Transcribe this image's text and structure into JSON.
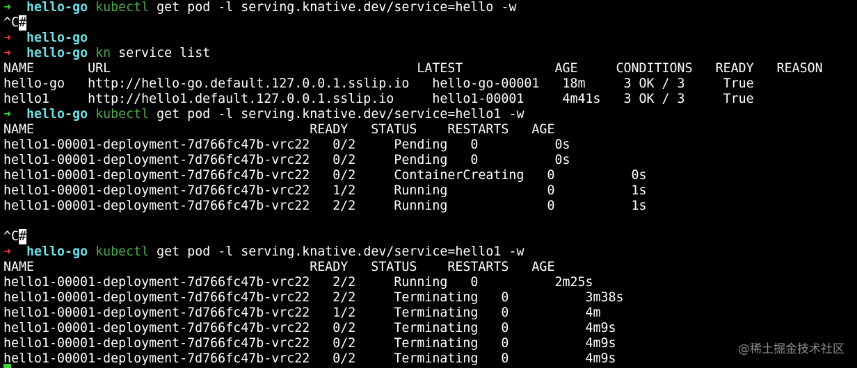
{
  "colors": {
    "background": "#000000",
    "text": "#ffffff",
    "prompt_arrow_success": "#38d838",
    "prompt_arrow_error": "#ee3a3a",
    "directory": "#6ee0e6",
    "command_name": "#4aa84a"
  },
  "prompt": {
    "arrow": "➜",
    "directory": "hello-go"
  },
  "session": {
    "cmd1": {
      "name": "kubectl",
      "args": " get pod -l serving.knative.dev/service=hello -w"
    },
    "interrupt": "^C",
    "cursor_char": "#",
    "cmd2": {
      "name": "kn",
      "args": " service list"
    },
    "service_header": "NAME       URL                                        LATEST            AGE     CONDITIONS   READY   REASON",
    "service_rows": [
      "hello-go   http://hello-go.default.127.0.0.1.sslip.io   hello-go-00001   18m     3 OK / 3     True",
      "hello1     http://hello1.default.127.0.0.1.sslip.io     hello1-00001     4m41s   3 OK / 3     True"
    ],
    "cmd3": {
      "name": "kubectl",
      "args": " get pod -l serving.knative.dev/service=hello1 -w"
    },
    "pod_header_1": "NAME                                    READY   STATUS    RESTARTS   AGE",
    "pod_rows_1": [
      "hello1-00001-deployment-7d766fc47b-vrc22   0/2     Pending   0          0s",
      "hello1-00001-deployment-7d766fc47b-vrc22   0/2     Pending   0          0s",
      "hello1-00001-deployment-7d766fc47b-vrc22   0/2     ContainerCreating   0          0s",
      "hello1-00001-deployment-7d766fc47b-vrc22   1/2     Running             0          1s",
      "hello1-00001-deployment-7d766fc47b-vrc22   2/2     Running             0          1s"
    ],
    "cmd4": {
      "name": "kubectl",
      "args": " get pod -l serving.knative.dev/service=hello1 -w"
    },
    "pod_header_2": "NAME                                    READY   STATUS    RESTARTS   AGE",
    "pod_rows_2": [
      "hello1-00001-deployment-7d766fc47b-vrc22   2/2     Running   0          2m25s",
      "hello1-00001-deployment-7d766fc47b-vrc22   2/2     Terminating   0          3m38s",
      "hello1-00001-deployment-7d766fc47b-vrc22   1/2     Terminating   0          4m",
      "hello1-00001-deployment-7d766fc47b-vrc22   0/2     Terminating   0          4m9s",
      "hello1-00001-deployment-7d766fc47b-vrc22   0/2     Terminating   0          4m9s",
      "hello1-00001-deployment-7d766fc47b-vrc22   0/2     Terminating   0          4m9s"
    ]
  },
  "watermark": "@稀土掘金技术社区"
}
